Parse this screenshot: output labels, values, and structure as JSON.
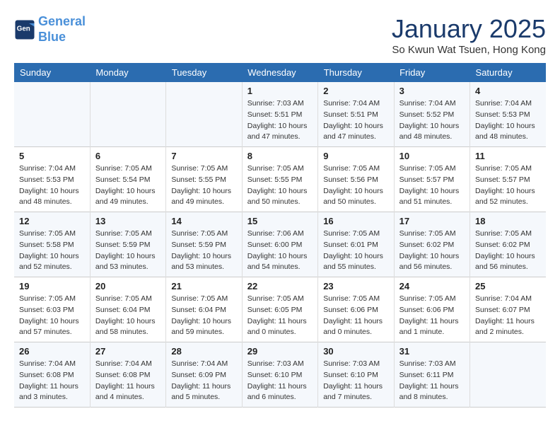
{
  "logo": {
    "line1": "General",
    "line2": "Blue"
  },
  "title": "January 2025",
  "subtitle": "So Kwun Wat Tsuen, Hong Kong",
  "headers": [
    "Sunday",
    "Monday",
    "Tuesday",
    "Wednesday",
    "Thursday",
    "Friday",
    "Saturday"
  ],
  "weeks": [
    [
      {
        "day": "",
        "info": ""
      },
      {
        "day": "",
        "info": ""
      },
      {
        "day": "",
        "info": ""
      },
      {
        "day": "1",
        "info": "Sunrise: 7:03 AM\nSunset: 5:51 PM\nDaylight: 10 hours\nand 47 minutes."
      },
      {
        "day": "2",
        "info": "Sunrise: 7:04 AM\nSunset: 5:51 PM\nDaylight: 10 hours\nand 47 minutes."
      },
      {
        "day": "3",
        "info": "Sunrise: 7:04 AM\nSunset: 5:52 PM\nDaylight: 10 hours\nand 48 minutes."
      },
      {
        "day": "4",
        "info": "Sunrise: 7:04 AM\nSunset: 5:53 PM\nDaylight: 10 hours\nand 48 minutes."
      }
    ],
    [
      {
        "day": "5",
        "info": "Sunrise: 7:04 AM\nSunset: 5:53 PM\nDaylight: 10 hours\nand 48 minutes."
      },
      {
        "day": "6",
        "info": "Sunrise: 7:05 AM\nSunset: 5:54 PM\nDaylight: 10 hours\nand 49 minutes."
      },
      {
        "day": "7",
        "info": "Sunrise: 7:05 AM\nSunset: 5:55 PM\nDaylight: 10 hours\nand 49 minutes."
      },
      {
        "day": "8",
        "info": "Sunrise: 7:05 AM\nSunset: 5:55 PM\nDaylight: 10 hours\nand 50 minutes."
      },
      {
        "day": "9",
        "info": "Sunrise: 7:05 AM\nSunset: 5:56 PM\nDaylight: 10 hours\nand 50 minutes."
      },
      {
        "day": "10",
        "info": "Sunrise: 7:05 AM\nSunset: 5:57 PM\nDaylight: 10 hours\nand 51 minutes."
      },
      {
        "day": "11",
        "info": "Sunrise: 7:05 AM\nSunset: 5:57 PM\nDaylight: 10 hours\nand 52 minutes."
      }
    ],
    [
      {
        "day": "12",
        "info": "Sunrise: 7:05 AM\nSunset: 5:58 PM\nDaylight: 10 hours\nand 52 minutes."
      },
      {
        "day": "13",
        "info": "Sunrise: 7:05 AM\nSunset: 5:59 PM\nDaylight: 10 hours\nand 53 minutes."
      },
      {
        "day": "14",
        "info": "Sunrise: 7:05 AM\nSunset: 5:59 PM\nDaylight: 10 hours\nand 53 minutes."
      },
      {
        "day": "15",
        "info": "Sunrise: 7:06 AM\nSunset: 6:00 PM\nDaylight: 10 hours\nand 54 minutes."
      },
      {
        "day": "16",
        "info": "Sunrise: 7:05 AM\nSunset: 6:01 PM\nDaylight: 10 hours\nand 55 minutes."
      },
      {
        "day": "17",
        "info": "Sunrise: 7:05 AM\nSunset: 6:02 PM\nDaylight: 10 hours\nand 56 minutes."
      },
      {
        "day": "18",
        "info": "Sunrise: 7:05 AM\nSunset: 6:02 PM\nDaylight: 10 hours\nand 56 minutes."
      }
    ],
    [
      {
        "day": "19",
        "info": "Sunrise: 7:05 AM\nSunset: 6:03 PM\nDaylight: 10 hours\nand 57 minutes."
      },
      {
        "day": "20",
        "info": "Sunrise: 7:05 AM\nSunset: 6:04 PM\nDaylight: 10 hours\nand 58 minutes."
      },
      {
        "day": "21",
        "info": "Sunrise: 7:05 AM\nSunset: 6:04 PM\nDaylight: 10 hours\nand 59 minutes."
      },
      {
        "day": "22",
        "info": "Sunrise: 7:05 AM\nSunset: 6:05 PM\nDaylight: 11 hours\nand 0 minutes."
      },
      {
        "day": "23",
        "info": "Sunrise: 7:05 AM\nSunset: 6:06 PM\nDaylight: 11 hours\nand 0 minutes."
      },
      {
        "day": "24",
        "info": "Sunrise: 7:05 AM\nSunset: 6:06 PM\nDaylight: 11 hours\nand 1 minute."
      },
      {
        "day": "25",
        "info": "Sunrise: 7:04 AM\nSunset: 6:07 PM\nDaylight: 11 hours\nand 2 minutes."
      }
    ],
    [
      {
        "day": "26",
        "info": "Sunrise: 7:04 AM\nSunset: 6:08 PM\nDaylight: 11 hours\nand 3 minutes."
      },
      {
        "day": "27",
        "info": "Sunrise: 7:04 AM\nSunset: 6:08 PM\nDaylight: 11 hours\nand 4 minutes."
      },
      {
        "day": "28",
        "info": "Sunrise: 7:04 AM\nSunset: 6:09 PM\nDaylight: 11 hours\nand 5 minutes."
      },
      {
        "day": "29",
        "info": "Sunrise: 7:03 AM\nSunset: 6:10 PM\nDaylight: 11 hours\nand 6 minutes."
      },
      {
        "day": "30",
        "info": "Sunrise: 7:03 AM\nSunset: 6:10 PM\nDaylight: 11 hours\nand 7 minutes."
      },
      {
        "day": "31",
        "info": "Sunrise: 7:03 AM\nSunset: 6:11 PM\nDaylight: 11 hours\nand 8 minutes."
      },
      {
        "day": "",
        "info": ""
      }
    ]
  ]
}
